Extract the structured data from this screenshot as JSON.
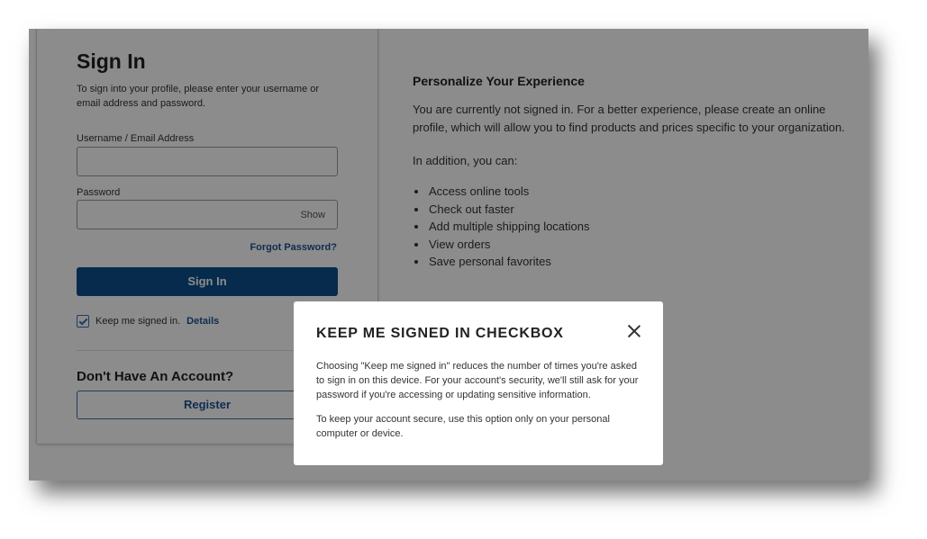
{
  "signin": {
    "title": "Sign In",
    "description": "To sign into your profile, please enter your username or email address and password.",
    "username_label": "Username / Email Address",
    "username_value": "",
    "password_label": "Password",
    "password_value": "",
    "show_label": "Show",
    "forgot_label": "Forgot Password?",
    "button_label": "Sign In",
    "keep_signed_in_label": "Keep me signed in.",
    "keep_signed_in_checked": true,
    "details_label": "Details",
    "no_account_title": "Don't Have An Account?",
    "register_label": "Register"
  },
  "info": {
    "title": "Personalize Your Experience",
    "text": "You are currently not signed in. For a better experience, please create an online profile, which will allow you to find products and prices specific to your organization.",
    "subtitle": "In addition, you can:",
    "benefits": [
      "Access online tools",
      "Check out faster",
      "Add multiple shipping locations",
      "View orders",
      "Save personal favorites"
    ]
  },
  "modal": {
    "title": "KEEP ME SIGNED IN CHECKBOX",
    "close_icon": "close-icon",
    "paragraph1": "Choosing \"Keep me signed in\" reduces the number of times you're asked to sign in on this device. For your account's security, we'll still ask for your password if you're accessing or updating sensitive information.",
    "paragraph2": "To keep your account secure, use this option only on your personal computer or device."
  },
  "colors": {
    "primary": "#0b4f8a",
    "link": "#1d5394",
    "overlay": "rgba(0,0,0,0.45)"
  }
}
